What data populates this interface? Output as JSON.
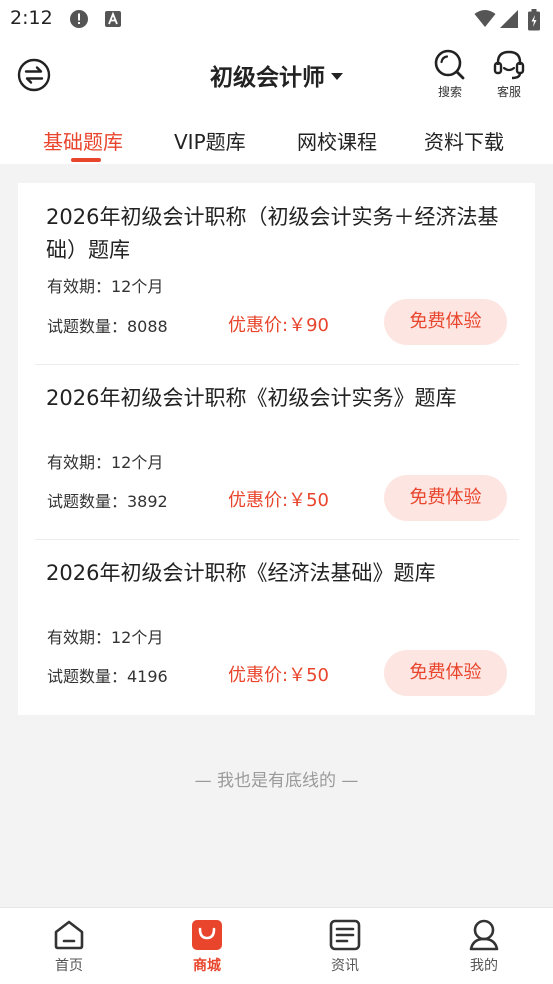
{
  "status_bar": {
    "time": "2:12",
    "icons": [
      "alert-icon",
      "accessibility-icon",
      "wifi-icon",
      "signal-icon",
      "battery-icon"
    ]
  },
  "header": {
    "title": "初级会计师",
    "search_label": "搜索",
    "service_label": "客服"
  },
  "tabs": [
    {
      "label": "基础题库",
      "active": true
    },
    {
      "label": "VIP题库",
      "active": false
    },
    {
      "label": "网校课程",
      "active": false
    },
    {
      "label": "资料下载",
      "active": false
    }
  ],
  "products": [
    {
      "name": "2026年初级会计职称（初级会计实务＋经济法基础）题库",
      "validity": "有效期：12个月",
      "count": "试题数量：8088",
      "price": "优惠价:￥90",
      "button": "免费体验"
    },
    {
      "name": "2026年初级会计职称《初级会计实务》题库",
      "validity": "有效期：12个月",
      "count": "试题数量：3892",
      "price": "优惠价:￥50",
      "button": "免费体验"
    },
    {
      "name": "2026年初级会计职称《经济法基础》题库",
      "validity": "有效期：12个月",
      "count": "试题数量：4196",
      "price": "优惠价:￥50",
      "button": "免费体验"
    }
  ],
  "footer_note": "— 我也是有底线的 —",
  "bottom_nav": [
    {
      "label": "首页",
      "icon": "home-icon",
      "active": false
    },
    {
      "label": "商城",
      "icon": "shop-icon",
      "active": true
    },
    {
      "label": "资讯",
      "icon": "news-icon",
      "active": false
    },
    {
      "label": "我的",
      "icon": "profile-icon",
      "active": false
    }
  ],
  "colors": {
    "accent": "#e8452c",
    "button_bg": "#fde5e2",
    "page_bg": "#f3f3f3"
  }
}
